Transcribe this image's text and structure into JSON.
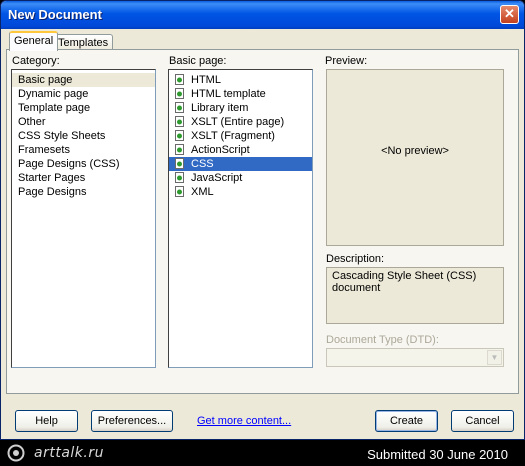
{
  "window": {
    "title": "New Document",
    "close_symbol": "✕"
  },
  "tabs": [
    {
      "label": "General"
    },
    {
      "label": "Templates"
    }
  ],
  "category": {
    "label": "Category:",
    "items": [
      "Basic page",
      "Dynamic page",
      "Template page",
      "Other",
      "CSS Style Sheets",
      "Framesets",
      "Page Designs (CSS)",
      "Starter Pages",
      "Page Designs"
    ],
    "selected": "Basic page"
  },
  "basic_page": {
    "label": "Basic page:",
    "items": [
      "HTML",
      "HTML template",
      "Library item",
      "XSLT (Entire page)",
      "XSLT (Fragment)",
      "ActionScript",
      "CSS",
      "JavaScript",
      "XML"
    ],
    "selected": "CSS",
    "icon": "document-icon"
  },
  "preview": {
    "label": "Preview:",
    "text": "<No preview>"
  },
  "description": {
    "label": "Description:",
    "text": "Cascading Style Sheet (CSS) document"
  },
  "doctype": {
    "label": "Document Type (DTD):",
    "value": ""
  },
  "buttons": {
    "help": "Help",
    "preferences": "Preferences...",
    "get_more": "Get more content...",
    "create": "Create",
    "cancel": "Cancel"
  },
  "footer": {
    "logo": "arttalk.ru",
    "submitted": "Submitted 30 June 2010"
  },
  "colors": {
    "selection": "#316ac5",
    "titlebar": "#0055e5",
    "dialog": "#ece9d8"
  }
}
